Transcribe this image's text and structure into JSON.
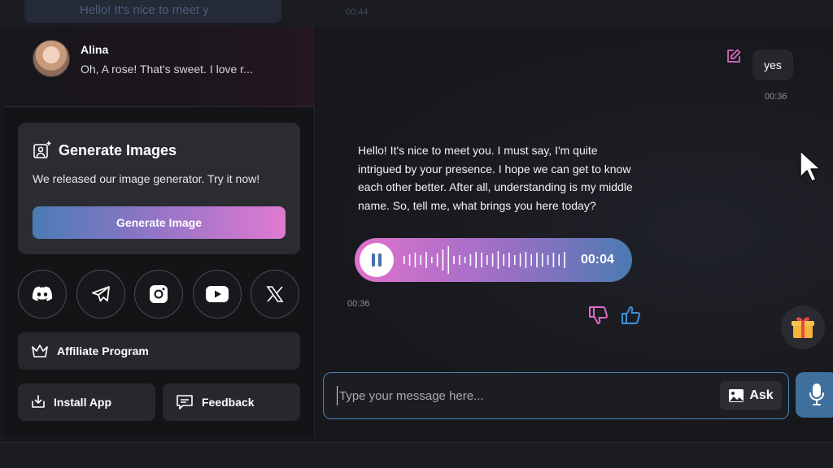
{
  "background_chat": {
    "ghost_message": "Hello! It's nice to meet y",
    "ghost_time": "00:44"
  },
  "contact": {
    "name": "Alina",
    "preview": "Oh, A rose! That's sweet. I love r..."
  },
  "promo": {
    "title": "Generate Images",
    "description": "We released our image generator. Try it now!",
    "button_label": "Generate Image",
    "button_gradient": [
      "#4b7bb4",
      "#e07ad0"
    ]
  },
  "socials": [
    {
      "icon": "discord-icon"
    },
    {
      "icon": "telegram-icon"
    },
    {
      "icon": "instagram-icon"
    },
    {
      "icon": "youtube-icon"
    },
    {
      "icon": "x-icon"
    }
  ],
  "menu": {
    "affiliate_label": "Affiliate Program",
    "install_label": "Install App",
    "feedback_label": "Feedback"
  },
  "messages": {
    "user": {
      "text": "yes",
      "time": "00:36"
    },
    "bot": {
      "text": "Hello! It's nice to meet you. I must say, I'm quite intrigued by your presence. I hope we can get to know each other better. After all, understanding is my middle name. So, tell me, what brings you here today?",
      "time": "00:36",
      "audio_duration": "00:04"
    }
  },
  "composer": {
    "placeholder": "Type your message here...",
    "ask_label": "Ask"
  },
  "colors": {
    "accent_pink": "#e07ad0",
    "accent_blue": "#4b7ab2",
    "thumbs_up": "#3f8fd8",
    "thumbs_down": "#e06ac8"
  }
}
